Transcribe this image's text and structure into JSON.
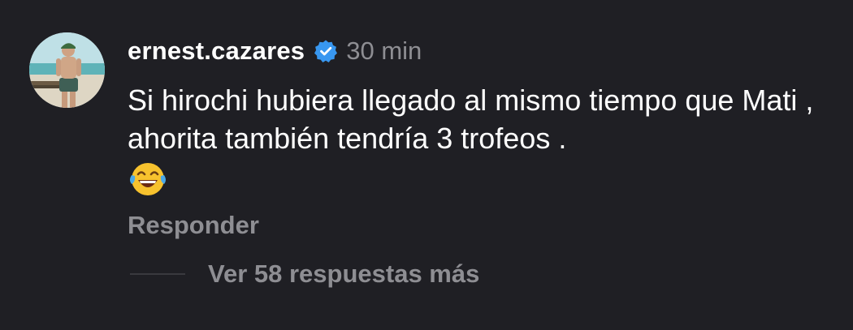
{
  "comment": {
    "username": "ernest.cazares",
    "verified": true,
    "timestamp": "30 min",
    "text": "Si hirochi hubiera llegado al mismo tiempo que Mati , ahorita también tendría 3 trofeos .",
    "emoji": "face-with-tears-of-joy-icon",
    "reply_label": "Responder",
    "view_replies_label": "Ver 58 respuestas más"
  },
  "colors": {
    "background": "#1f1f24",
    "primary_text": "#ffffff",
    "secondary_text": "#8e8e93",
    "verified_badge": "#3897f0"
  }
}
